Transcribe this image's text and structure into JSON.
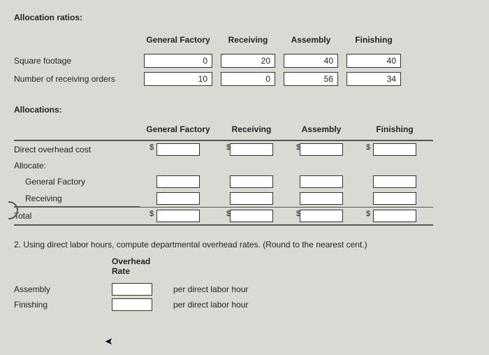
{
  "section1": {
    "title": "Allocation ratios:"
  },
  "cols": {
    "gf": "General Factory",
    "rec": "Receiving",
    "asm": "Assembly",
    "fin": "Finishing"
  },
  "ratios": {
    "rows": [
      {
        "label": "Square footage",
        "gf": "0",
        "rec": "20",
        "asm": "40",
        "fin": "40"
      },
      {
        "label": "Number of receiving orders",
        "gf": "10",
        "rec": "0",
        "asm": "56",
        "fin": "34"
      }
    ]
  },
  "section2": {
    "title": "Allocations:"
  },
  "alloc": {
    "rows": {
      "direct": "Direct overhead cost",
      "allocate": "Allocate:",
      "gf": "General Factory",
      "rec": "Receiving",
      "total": "Total"
    }
  },
  "q2": {
    "text": "2. Using direct labor hours, compute departmental overhead rates. (Round to the nearest cent.)",
    "header": "Overhead Rate",
    "rows": {
      "asm": "Assembly",
      "fin": "Finishing"
    },
    "unit": "per direct labor hour"
  }
}
